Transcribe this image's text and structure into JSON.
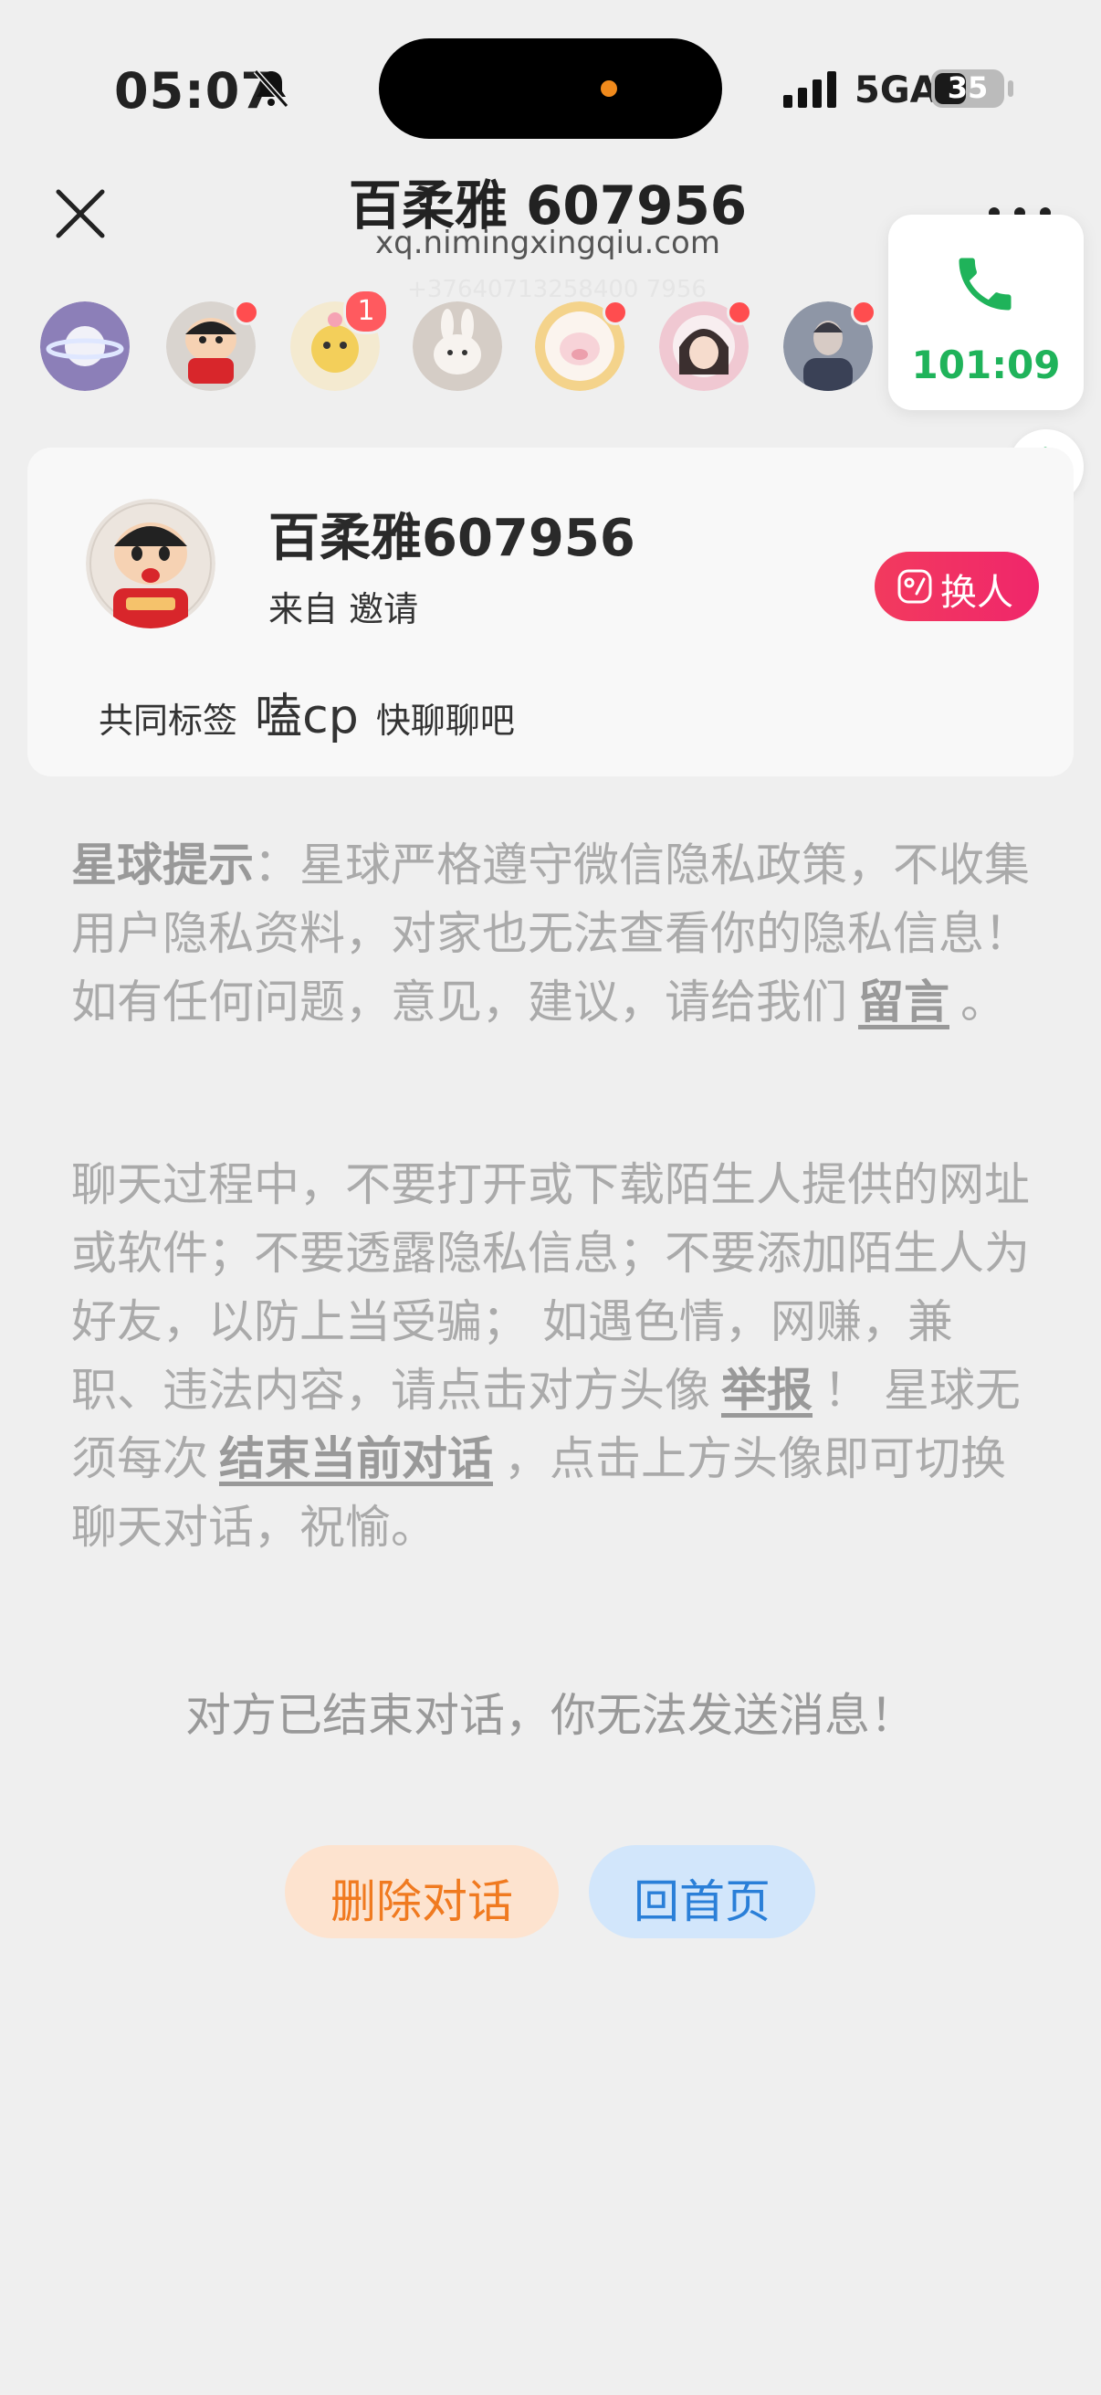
{
  "status_bar": {
    "time": "05:07",
    "network": "5GA",
    "battery": "35",
    "icons": [
      "bell-muted-icon",
      "signal-icon",
      "battery-charging-icon"
    ]
  },
  "header": {
    "title": "百柔雅 607956",
    "subtitle": "xq.nimingxingqiu.com",
    "ghost_text": "+37640713258400 7956"
  },
  "avatar_strip": {
    "badge_count": "1"
  },
  "call": {
    "timer": "101:09"
  },
  "profile": {
    "name": "百柔雅607956",
    "from": "来自 邀请",
    "switch_label": "换人",
    "tags_label": "共同标签",
    "tag_main": "嗑cp",
    "tag_extra": "快聊聊吧"
  },
  "notice1": {
    "strong": "星球提示",
    "text": "：星球严格遵守微信隐私政策，不收集用户隐私资料，对家也无法查看你的隐私信息！ 如有任何问题，意见，建议，请给我们",
    "link": "留言",
    "end": "。"
  },
  "notice2": {
    "text_a": "聊天过程中，不要打开或下载陌生人提供的网址或软件；不要透露隐私信息；不要添加陌生人为好友，以防上当受骗； 如遇色情，网赚，兼职、违法内容，请点击对方头像",
    "link_report": "举报",
    "text_b": "！ 星球无须每次",
    "link_end": "结束当前对话",
    "text_c": "，点击上方头像即可切换聊天对话，祝愉。"
  },
  "ended_message": "对方已结束对话，你无法发送消息！",
  "actions": {
    "delete_label": "删除对话",
    "home_label": "回首页"
  },
  "colors": {
    "accent_red": "#f0266b",
    "call_green": "#1fb35a",
    "delete_orange": "#f07a20",
    "home_blue": "#2a7fd8",
    "background": "#efefef"
  }
}
